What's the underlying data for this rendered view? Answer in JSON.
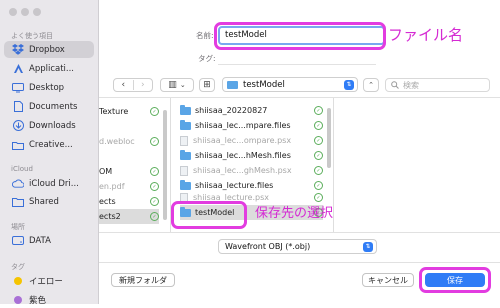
{
  "sidebar": {
    "favorites_header": "よく使う項目",
    "favorites": [
      {
        "label": "Dropbox",
        "icon": "dropbox-icon",
        "selected": true
      },
      {
        "label": "Applicati...",
        "icon": "applications-icon"
      },
      {
        "label": "Desktop",
        "icon": "desktop-icon"
      },
      {
        "label": "Documents",
        "icon": "document-icon"
      },
      {
        "label": "Downloads",
        "icon": "downloads-icon"
      },
      {
        "label": "Creative...",
        "icon": "creative-cloud-icon"
      }
    ],
    "icloud_header": "iCloud",
    "icloud": [
      {
        "label": "iCloud Dri...",
        "icon": "cloud-icon"
      },
      {
        "label": "Shared",
        "icon": "shared-folder-icon"
      }
    ],
    "locations_header": "場所",
    "locations": [
      {
        "label": "DATA",
        "icon": "drive-icon"
      }
    ],
    "tags_header": "タグ",
    "tags": [
      {
        "label": "イエロー",
        "color": "#f5c400"
      },
      {
        "label": "紫色",
        "color": "#a970d6"
      }
    ]
  },
  "save_as": {
    "label": "名前:",
    "value": "testModel"
  },
  "tags": {
    "label": "タグ:",
    "value": ""
  },
  "toolbar": {
    "back": "‹",
    "forward": "›",
    "view": "▥",
    "view_chevron": "⌄",
    "grid": "⊞",
    "location": "testModel",
    "search_placeholder": "検索"
  },
  "columns": {
    "col1": [
      {
        "name": "Texture",
        "kind": "text",
        "sync": true,
        "arrow": true
      },
      {
        "name": "d.webloc",
        "kind": "dim",
        "sync": true
      },
      {
        "name": "OM",
        "kind": "text",
        "sync": true,
        "arrow": true
      },
      {
        "name": "en.pdf",
        "kind": "dim",
        "sync": true
      },
      {
        "name": "ects",
        "kind": "text",
        "sync": true,
        "arrow": true
      },
      {
        "name": "ects2",
        "kind": "text",
        "sync": true,
        "arrow": true,
        "selected": true
      }
    ],
    "col2": [
      {
        "name": "shiisaa_20220827",
        "kind": "folder",
        "sync": true,
        "arrow": true
      },
      {
        "name": "shiisaa_lec...mpare.files",
        "kind": "folder",
        "sync": true,
        "arrow": true
      },
      {
        "name": "shiisaa_lec...ompare.psx",
        "kind": "file-dim",
        "sync": true
      },
      {
        "name": "shiisaa_lec...hMesh.files",
        "kind": "folder",
        "sync": true,
        "arrow": true
      },
      {
        "name": "shiisaa_lec...ghMesh.psx",
        "kind": "file-dim",
        "sync": true
      },
      {
        "name": "shiisaa_lecture.files",
        "kind": "folder",
        "sync": true,
        "arrow": true
      },
      {
        "name": "shiisaa_lecture.psx",
        "kind": "file-dim",
        "sync": true
      },
      {
        "name": "testModel",
        "kind": "folder",
        "sync": true,
        "arrow": true,
        "selected": true
      }
    ]
  },
  "format": {
    "value": "Wavefront OBJ (*.obj)"
  },
  "buttons": {
    "new_folder": "新規フォルダ",
    "cancel": "キャンセル",
    "save": "保存"
  },
  "annotations": {
    "file_name": "ファイル名",
    "save_location": "保存先の選択"
  },
  "colors": {
    "highlight": "#e23ce0",
    "accent": "#2f7cf6",
    "sync_green": "#5cae5c",
    "folder_blue": "#5aa5e6"
  }
}
